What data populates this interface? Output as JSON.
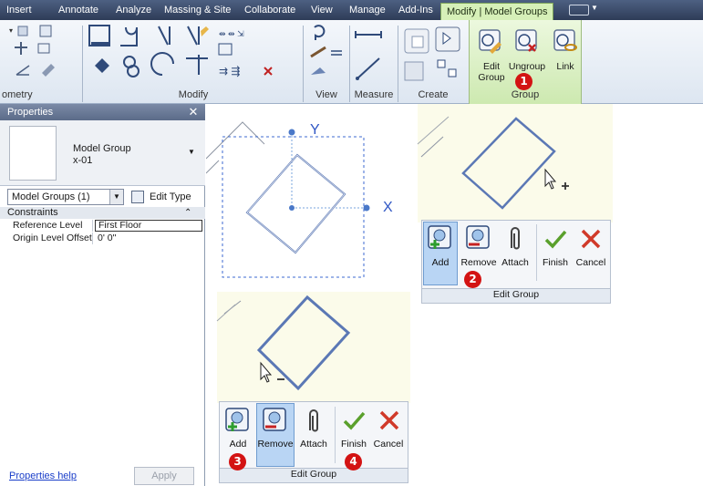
{
  "ribbon": {
    "tabs": [
      {
        "label": "Insert"
      },
      {
        "label": "Annotate"
      },
      {
        "label": "Analyze"
      },
      {
        "label": "Massing & Site"
      },
      {
        "label": "Collaborate"
      },
      {
        "label": "View"
      },
      {
        "label": "Manage"
      },
      {
        "label": "Add-Ins"
      },
      {
        "label": "Modify | Model Groups"
      }
    ],
    "panels": {
      "geometry": "ometry",
      "modify": "Modify",
      "view": "View",
      "measure": "Measure",
      "create": "Create",
      "group": "Group"
    },
    "group_buttons": {
      "edit_group": "Edit Group",
      "ungroup": "Ungroup",
      "link": "Link"
    }
  },
  "properties": {
    "title": "Properties",
    "type_name": "Model Group",
    "type_sub": "x-01",
    "filter": "Model Groups (1)",
    "edit_type": "Edit Type",
    "section": "Constraints",
    "rows": [
      {
        "key": "Reference Level",
        "value": "First Floor"
      },
      {
        "key": "Origin Level Offset",
        "value": "0'  0\""
      }
    ],
    "help": "Properties help",
    "apply": "Apply"
  },
  "canvas": {
    "axis_y": "Y",
    "axis_x": "X"
  },
  "edit_group_toolbar": {
    "add": "Add",
    "remove": "Remove",
    "attach": "Attach",
    "finish": "Finish",
    "cancel": "Cancel",
    "footer": "Edit Group"
  },
  "badges": [
    "1",
    "2",
    "3",
    "4"
  ],
  "colors": {
    "ribbon_tab_bar": "#3c4b68",
    "contextual_tab": "#d6f0b8",
    "group_outline": "#5b78b5",
    "canvas_highlight": "#fbfbea",
    "badge": "#d31313",
    "finish_check": "#5aa02c",
    "cancel_x": "#d03a2a"
  }
}
